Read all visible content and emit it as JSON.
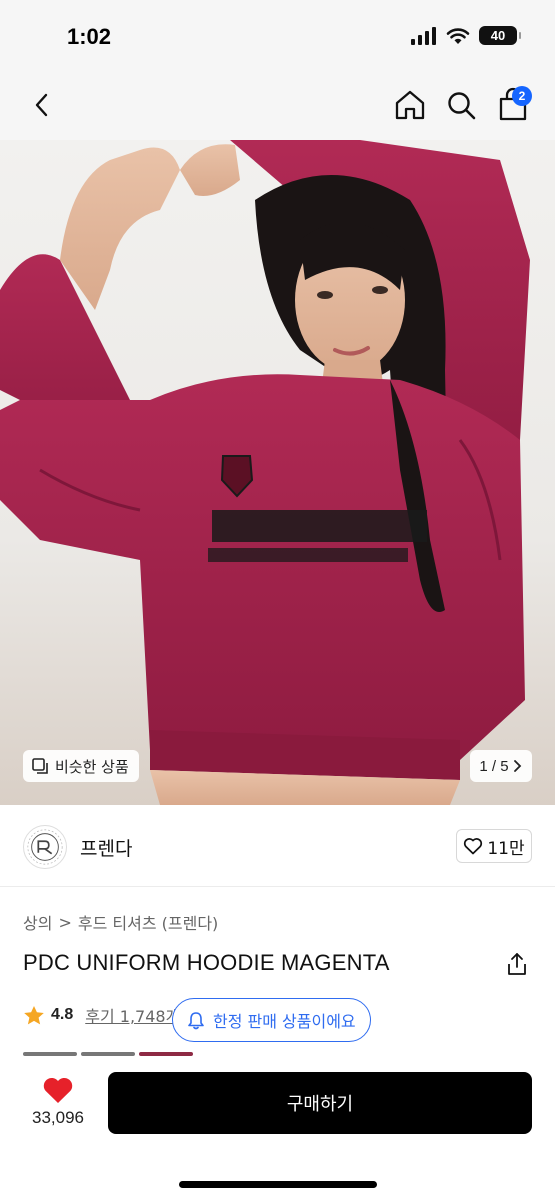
{
  "status_bar": {
    "time": "1:02",
    "battery": "40"
  },
  "nav": {
    "cart_count": "2",
    "icons": [
      "chevron-left-icon",
      "home-icon",
      "search-icon",
      "shopping-bag-icon"
    ]
  },
  "hero": {
    "image_alt": "",
    "similar_label": "비슷한 상품",
    "counter": "1 / 5",
    "colors": {
      "hoodie": "#a3214b"
    }
  },
  "store": {
    "name": "프렌다",
    "likes": "11만"
  },
  "breadcrumb": {
    "level1": "상의",
    "separator": ">",
    "level2": "후드 티셔츠 (프렌다)"
  },
  "product": {
    "title": "PDC UNIFORM HOODIE MAGENTA",
    "rating": "4.8",
    "reviews_label": "후기 1,748개",
    "limited_label": "한정 판매 상품이에요"
  },
  "bottom_bar": {
    "wish_count": "33,096",
    "buy_label": "구매하기"
  },
  "colors": {
    "accent_blue": "#2f6cf0",
    "badge_blue": "#1565ff",
    "heart_red": "#e6212a",
    "star": "#f5a623"
  }
}
